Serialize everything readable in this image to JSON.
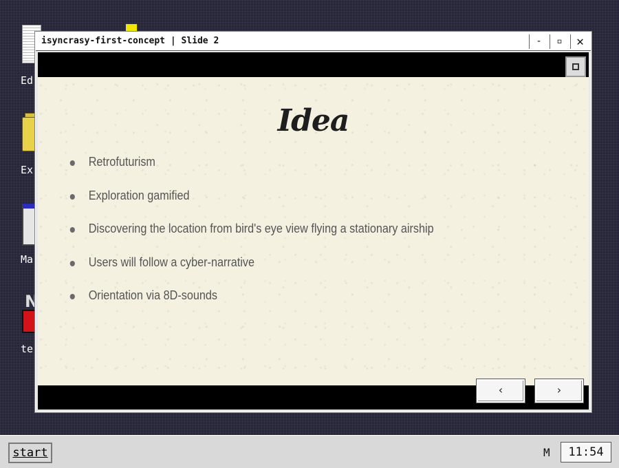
{
  "desktop": {
    "icons": [
      {
        "label": "Ed",
        "icon": "text-editor-icon"
      },
      {
        "label": "Ex",
        "icon": "folder-icon"
      },
      {
        "label": "Ma",
        "icon": "window-icon"
      },
      {
        "label": "te",
        "icon": "terminal-icon"
      }
    ]
  },
  "window": {
    "title": "isyncrasy-first-concept | Slide 2",
    "minimize_label": "-",
    "maximize_label": "▫",
    "close_label": "✕"
  },
  "slide": {
    "title": "Idea",
    "bullets": [
      "Retrofuturism",
      "Exploration gamified",
      "Discovering the location from bird's eye view flying a stationary airship",
      "Users will follow a cyber-narrative",
      "Orientation via 8D-sounds"
    ],
    "prev_label": "‹",
    "next_label": "›",
    "fullscreen_icon": "fullscreen-icon"
  },
  "taskbar": {
    "start_label": "start",
    "tray_indicator": "M",
    "clock": "11:54"
  }
}
